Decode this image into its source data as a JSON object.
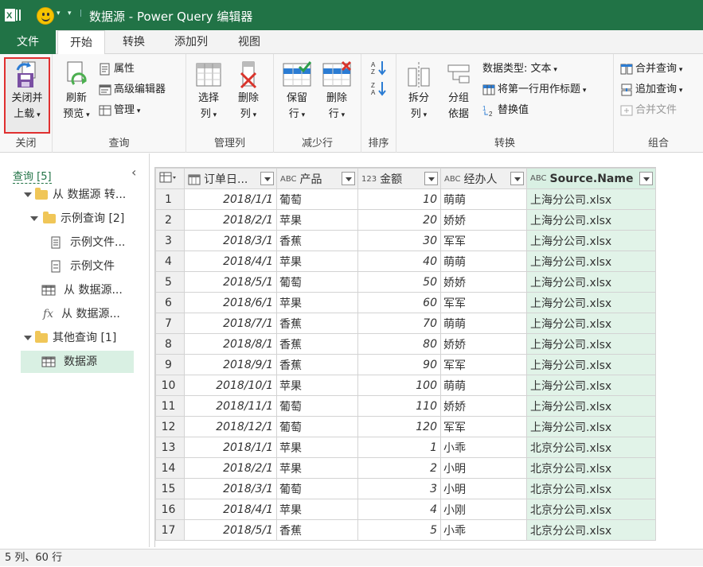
{
  "window": {
    "title": "数据源 - Power Query 编辑器",
    "accent_color": "#217346"
  },
  "tabs": [
    "文件",
    "开始",
    "转换",
    "添加列",
    "视图"
  ],
  "ribbon": {
    "close": {
      "btn_line1": "关闭并",
      "btn_line2": "上载",
      "group": "关闭"
    },
    "query": {
      "refresh_line1": "刷新",
      "refresh_line2": "预览",
      "properties": "属性",
      "advanced_editor": "高级编辑器",
      "manage": "管理",
      "group": "查询"
    },
    "manage_cols": {
      "choose_line1": "选择",
      "choose_line2": "列",
      "remove_line1": "删除",
      "remove_line2": "列",
      "group": "管理列"
    },
    "reduce_rows": {
      "keep_line1": "保留",
      "keep_line2": "行",
      "remove_line1": "删除",
      "remove_line2": "行",
      "group": "减少行"
    },
    "sort": {
      "group": "排序"
    },
    "transform": {
      "split_line1": "拆分",
      "split_line2": "列",
      "group_line1": "分组",
      "group_line2": "依据",
      "data_type": "数据类型: 文本",
      "first_row_header": "将第一行用作标题",
      "replace_values": "替换值",
      "group": "转换"
    },
    "combine": {
      "merge_queries": "合并查询",
      "append_queries": "追加查询",
      "combine_files": "合并文件",
      "group": "组合"
    }
  },
  "queries_panel": {
    "header": "查询 [5]",
    "items": [
      {
        "label": "从 数据源 转...",
        "kind": "folder"
      },
      {
        "label": "示例查询 [2]",
        "kind": "folder"
      },
      {
        "label": "示例文件...",
        "kind": "param"
      },
      {
        "label": "示例文件",
        "kind": "doc"
      },
      {
        "label": "从 数据源...",
        "kind": "table"
      },
      {
        "label": "从 数据源...",
        "kind": "fx"
      },
      {
        "label": "其他查询 [1]",
        "kind": "folder"
      },
      {
        "label": "数据源",
        "kind": "table"
      }
    ]
  },
  "grid": {
    "columns": [
      {
        "name": "订单日...",
        "type_icon": "calendar-icon"
      },
      {
        "name": "产品",
        "type_icon": "ABC"
      },
      {
        "name": "金额",
        "type_icon": "123"
      },
      {
        "name": "经办人",
        "type_icon": "ABC"
      },
      {
        "name": "Source.Name",
        "type_icon": "ABC"
      }
    ],
    "rows": [
      [
        "1",
        "2018/1/1",
        "葡萄",
        "10",
        "萌萌",
        "上海分公司.xlsx"
      ],
      [
        "2",
        "2018/2/1",
        "苹果",
        "20",
        "娇娇",
        "上海分公司.xlsx"
      ],
      [
        "3",
        "2018/3/1",
        "香蕉",
        "30",
        "军军",
        "上海分公司.xlsx"
      ],
      [
        "4",
        "2018/4/1",
        "苹果",
        "40",
        "萌萌",
        "上海分公司.xlsx"
      ],
      [
        "5",
        "2018/5/1",
        "葡萄",
        "50",
        "娇娇",
        "上海分公司.xlsx"
      ],
      [
        "6",
        "2018/6/1",
        "苹果",
        "60",
        "军军",
        "上海分公司.xlsx"
      ],
      [
        "7",
        "2018/7/1",
        "香蕉",
        "70",
        "萌萌",
        "上海分公司.xlsx"
      ],
      [
        "8",
        "2018/8/1",
        "香蕉",
        "80",
        "娇娇",
        "上海分公司.xlsx"
      ],
      [
        "9",
        "2018/9/1",
        "香蕉",
        "90",
        "军军",
        "上海分公司.xlsx"
      ],
      [
        "10",
        "2018/10/1",
        "苹果",
        "100",
        "萌萌",
        "上海分公司.xlsx"
      ],
      [
        "11",
        "2018/11/1",
        "葡萄",
        "110",
        "娇娇",
        "上海分公司.xlsx"
      ],
      [
        "12",
        "2018/12/1",
        "葡萄",
        "120",
        "军军",
        "上海分公司.xlsx"
      ],
      [
        "13",
        "2018/1/1",
        "苹果",
        "1",
        "小乖",
        "北京分公司.xlsx"
      ],
      [
        "14",
        "2018/2/1",
        "苹果",
        "2",
        "小明",
        "北京分公司.xlsx"
      ],
      [
        "15",
        "2018/3/1",
        "葡萄",
        "3",
        "小明",
        "北京分公司.xlsx"
      ],
      [
        "16",
        "2018/4/1",
        "苹果",
        "4",
        "小刚",
        "北京分公司.xlsx"
      ],
      [
        "17",
        "2018/5/1",
        "香蕉",
        "5",
        "小乖",
        "北京分公司.xlsx"
      ]
    ]
  },
  "status": "5 列、60 行"
}
